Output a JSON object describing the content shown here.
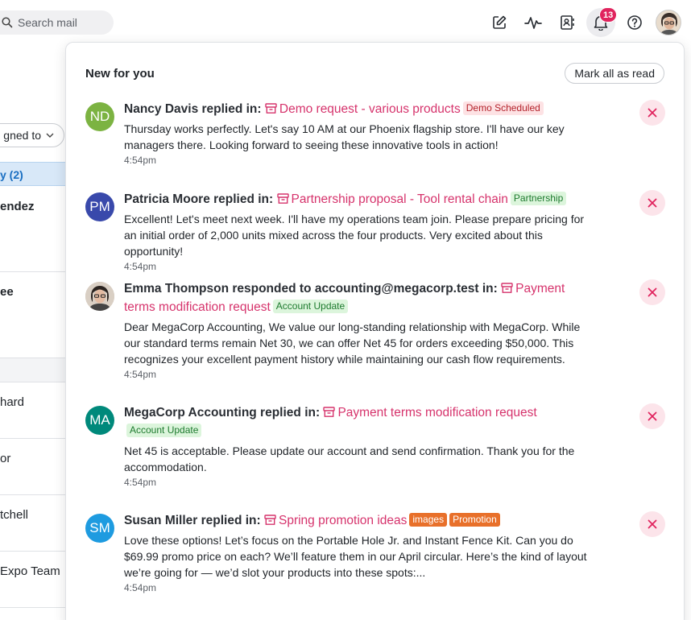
{
  "search": {
    "placeholder": "Search mail"
  },
  "topbar": {
    "notification_count": "13"
  },
  "background": {
    "assign_label": "gned to",
    "section_label": "y (2)",
    "rows": [
      "endez",
      "ee",
      "hard",
      "or",
      "tchell",
      "Expo Team"
    ]
  },
  "panel": {
    "title": "New for you",
    "mark_all_label": "Mark all as read",
    "notifications": [
      {
        "initials": "ND",
        "avatar_color": "#7cb342",
        "who": "Nancy Davis",
        "action": " replied in: ",
        "subject": "Demo request - various products",
        "tags": [
          {
            "label": "Demo Scheduled",
            "style": "red"
          }
        ],
        "text": "Thursday works perfectly. Let's say 10 AM at our Phoenix flagship store. I'll have our key managers there. Looking forward to seeing these innovative tools in action!",
        "time": "4:54pm"
      },
      {
        "initials": "PM",
        "avatar_color": "#3949ab",
        "who": "Patricia Moore",
        "action": " replied in: ",
        "subject": "Partnership proposal - Tool rental chain",
        "tags": [
          {
            "label": "Partnership",
            "style": "green"
          }
        ],
        "text": "Excellent! Let's meet next week. I'll have my operations team join. Please prepare pricing for an initial order of 2,000 units mixed across the four products. Very excited about this opportunity!",
        "time": "4:54pm"
      },
      {
        "initials": "",
        "avatar_color": "#c9b7a6",
        "who": "Emma Thompson",
        "action": " responded to accounting@megacorp.test in: ",
        "subject": "Payment terms modification request",
        "tags": [
          {
            "label": "Account Update",
            "style": "green"
          }
        ],
        "text": "Dear MegaCorp Accounting, We value our long-standing relationship with MegaCorp. While our standard terms remain Net 30, we can offer Net 45 for orders exceeding $50,000. This recognizes your excellent payment history while maintaining our cash flow requirements. Would",
        "time": "4:54pm"
      },
      {
        "initials": "MA",
        "avatar_color": "#00897b",
        "who": "MegaCorp Accounting",
        "action": " replied in: ",
        "subject": "Payment terms modification request",
        "tags": [
          {
            "label": "Account Update",
            "style": "green"
          }
        ],
        "text": "Net 45 is acceptable. Please update our account and send confirmation. Thank you for the accommodation.",
        "time": "4:54pm"
      },
      {
        "initials": "SM",
        "avatar_color": "#1e9be0",
        "who": "Susan Miller",
        "action": " replied in: ",
        "subject": "Spring promotion ideas",
        "tags": [
          {
            "label": "images",
            "style": "orange"
          },
          {
            "label": "Promotion",
            "style": "orange"
          }
        ],
        "text": "Love these options! Let’s focus on the Portable Hole Jr. and Instant Fence Kit. Can you do $69.99 promo price on each? We’ll feature them in our April circular. Here’s the kind of layout we’re going for — we’d slot your products into these spots:...",
        "time": "4:54pm"
      }
    ]
  }
}
